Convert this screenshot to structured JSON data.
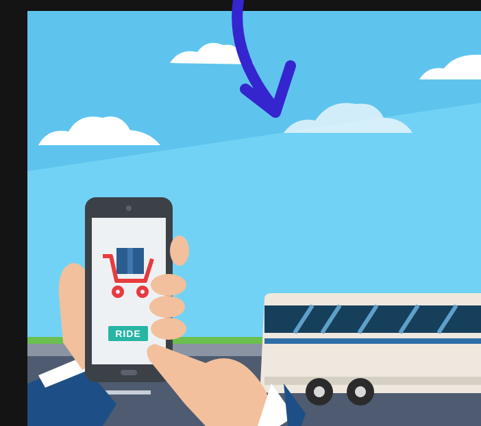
{
  "scene": {
    "phone_screen": {
      "button_label": "RIDE"
    },
    "colors": {
      "frame": "#141414",
      "sky": "#5ec4ee",
      "sky_band": "#72d2f5",
      "cloud": "#ffffff",
      "arrow": "#3425cf",
      "phone_body": "#3c4148",
      "phone_screen": "#eef1f4",
      "cart": "#e83b3f",
      "package": "#2a5c8f",
      "ride_button": "#27b5a4",
      "skin": "#f2c09c",
      "sleeve": "#1d4f86",
      "bus_body": "#efe8de",
      "bus_window": "#163f5c",
      "bus_stripe": "#2e6fa6",
      "road": "#4e5b70",
      "grass": "#6bbf4e"
    },
    "icons": [
      "arrow-icon",
      "cloud-icon",
      "smartphone-icon",
      "shopping-cart-icon",
      "package-icon",
      "bus-icon",
      "hand-icon"
    ]
  }
}
